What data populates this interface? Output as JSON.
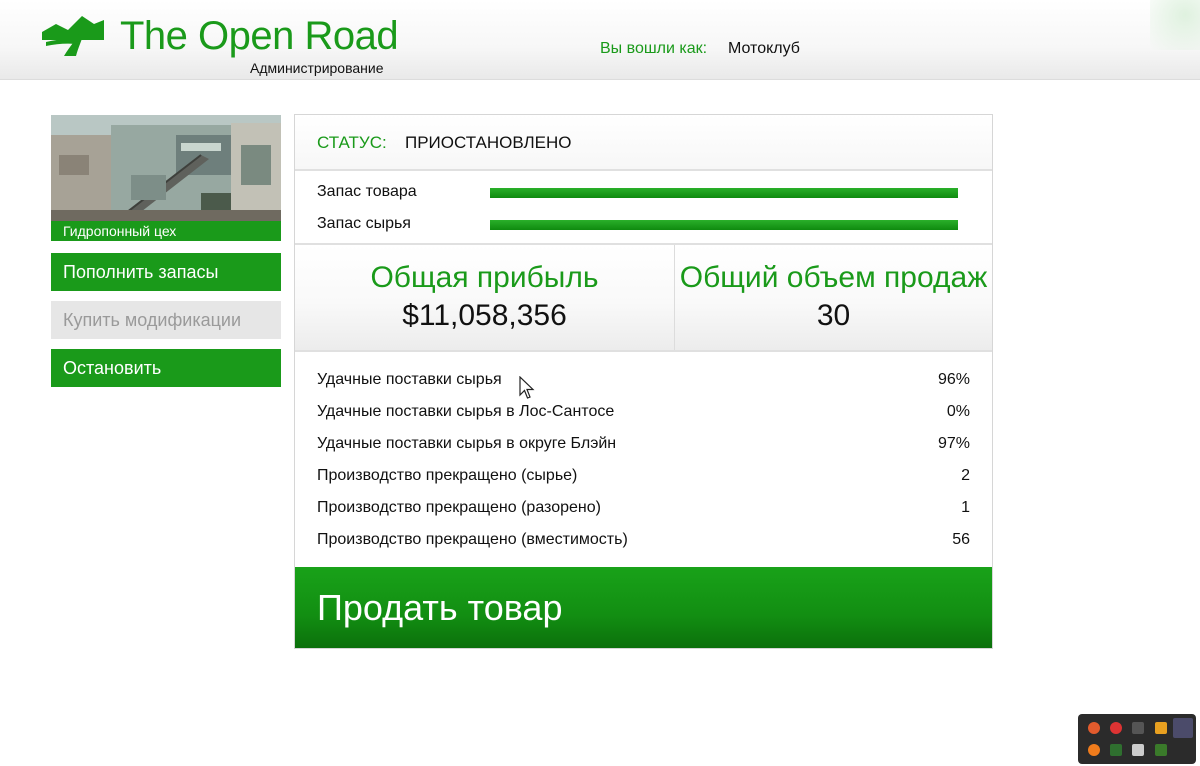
{
  "header": {
    "brand": "The Open Road",
    "subtitle": "Администрирование",
    "login_label": "Вы вошли как:",
    "login_user": "Мотоклуб"
  },
  "business": {
    "image_caption": "Гидропонный цех"
  },
  "sidebar": {
    "buttons": [
      {
        "label": "Пополнить запасы",
        "enabled": true
      },
      {
        "label": "Купить модификации",
        "enabled": false
      },
      {
        "label": "Остановить",
        "enabled": true
      }
    ]
  },
  "status": {
    "label": "СТАТУС:",
    "value": "ПРИОСТАНОВЛЕНО"
  },
  "supplies": [
    {
      "label": "Запас товара",
      "level": 1.0
    },
    {
      "label": "Запас сырья",
      "level": 1.0
    }
  ],
  "stats": {
    "profit_title": "Общая прибыль",
    "profit_value": "$11,058,356",
    "sales_title": "Общий объем продаж",
    "sales_value": "30"
  },
  "metrics": [
    {
      "label": "Удачные поставки сырья",
      "value": "96%"
    },
    {
      "label": "Удачные поставки сырья в Лос-Сантосе",
      "value": "0%"
    },
    {
      "label": "Удачные поставки сырья в округе Блэйн",
      "value": "97%"
    },
    {
      "label": "Производство прекращено (сырье)",
      "value": "2"
    },
    {
      "label": "Производство прекращено (разорено)",
      "value": "1"
    },
    {
      "label": "Производство прекращено (вместимость)",
      "value": "56"
    }
  ],
  "sell_button": {
    "label": "Продать товар"
  },
  "colors": {
    "accent": "#1a9a1a",
    "disabled_bg": "#e6e6e6",
    "disabled_text": "#9a9a9a"
  },
  "tray_icons": [
    "flame-icon",
    "chrome-icon",
    "telegram-icon",
    "archive-icon",
    "feather-icon",
    "orange-app-icon",
    "runner-icon",
    "excel-icon",
    "nvidia-icon"
  ]
}
